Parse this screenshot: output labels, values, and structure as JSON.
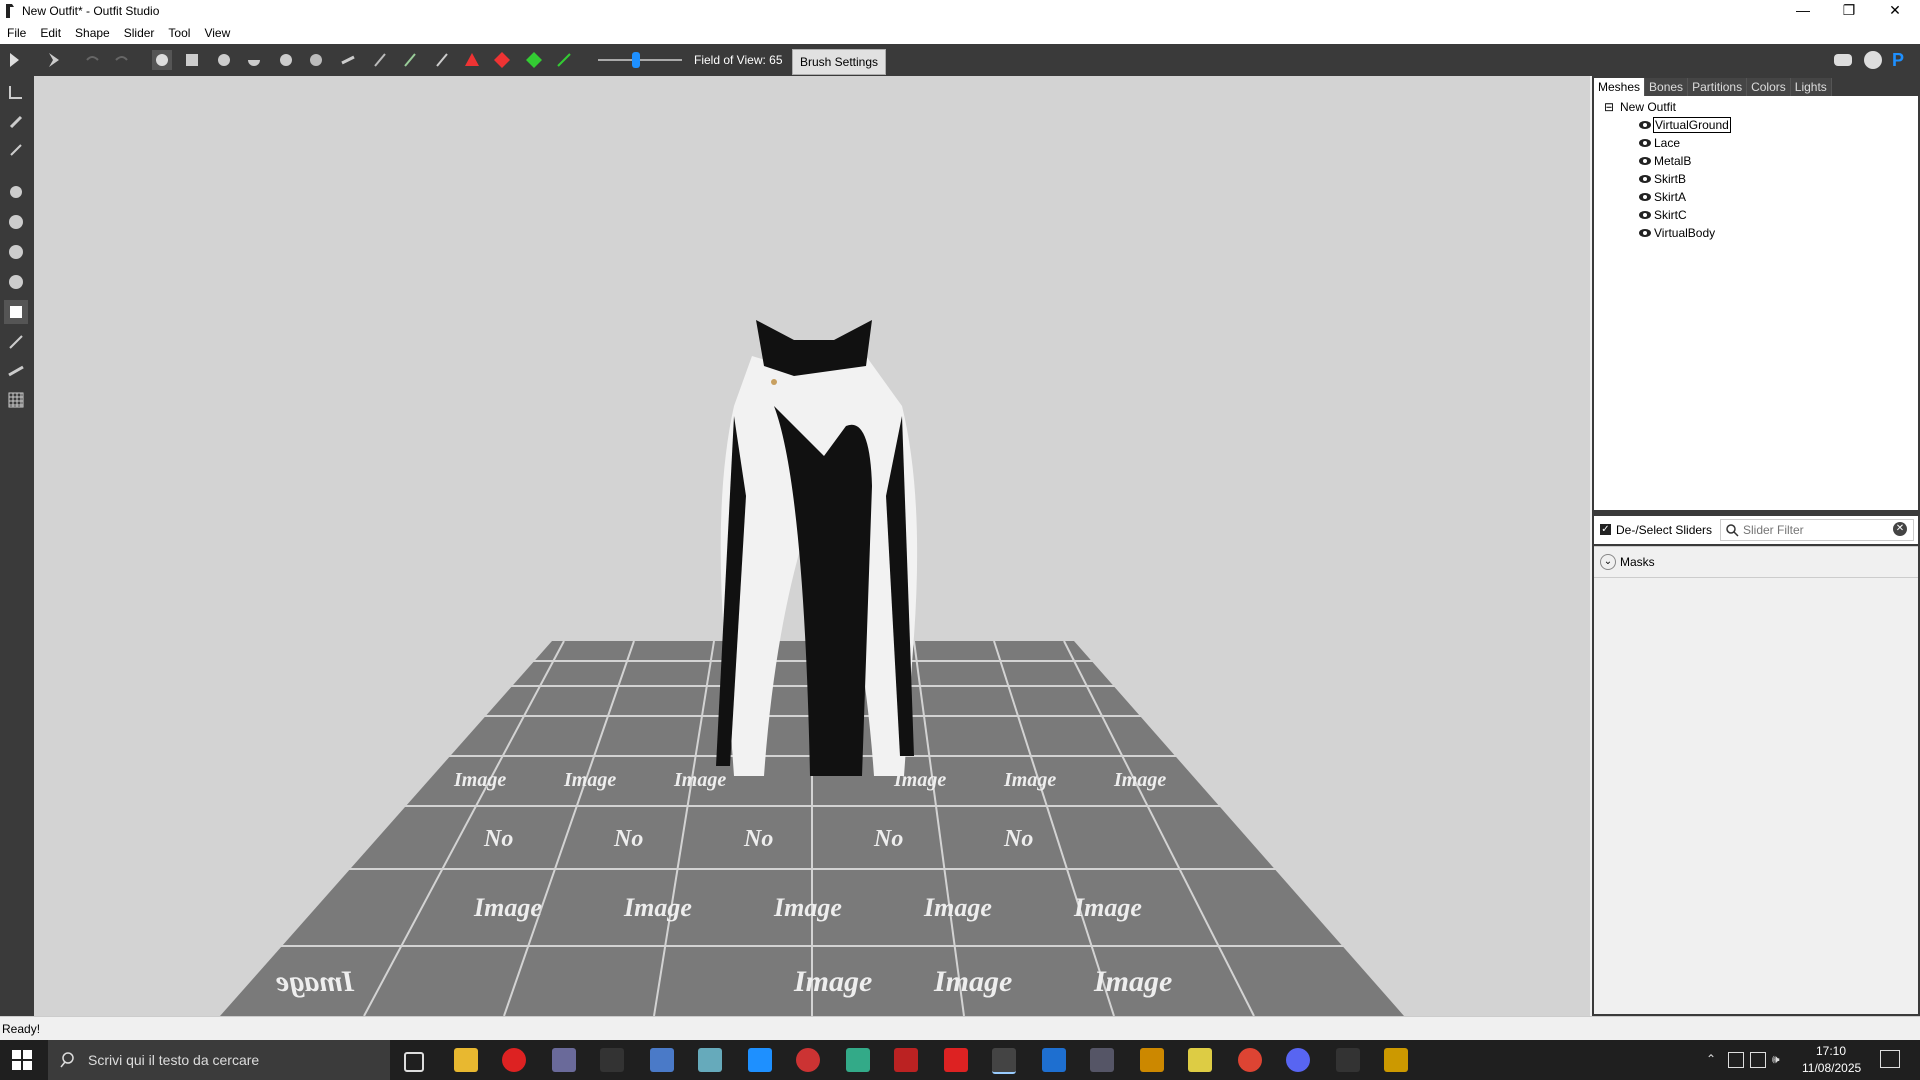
{
  "window": {
    "title": "New Outfit* - Outfit Studio"
  },
  "menu": {
    "items": [
      "File",
      "Edit",
      "Shape",
      "Slider",
      "Tool",
      "View"
    ]
  },
  "toolbar": {
    "fov_label": "Field of View: 65",
    "brush_settings": "Brush Settings"
  },
  "panel": {
    "tabs": [
      "Meshes",
      "Bones",
      "Partitions",
      "Colors",
      "Lights"
    ],
    "tree_root": "New Outfit",
    "meshes": [
      "VirtualGround",
      "Lace",
      "MetalB",
      "SkirtB",
      "SkirtA",
      "SkirtC",
      "VirtualBody"
    ],
    "selected_mesh": "VirtualGround"
  },
  "sliders": {
    "deselect_label": "De-/Select Sliders",
    "filter_placeholder": "Slider Filter",
    "masks_label": "Masks"
  },
  "ground_tile": {
    "line1": "No",
    "line2": "Image"
  },
  "status": {
    "text": "Ready!"
  },
  "taskbar": {
    "search_placeholder": "Scrivi qui il testo da cercare",
    "time": "17:10",
    "date": "11/08/2025"
  },
  "colors": {
    "toolbar_bg": "#3a3a3a",
    "viewport_bg": "#d3d3d3",
    "taskbar_bg": "#1f1f1f",
    "accent": "#1e90ff"
  }
}
